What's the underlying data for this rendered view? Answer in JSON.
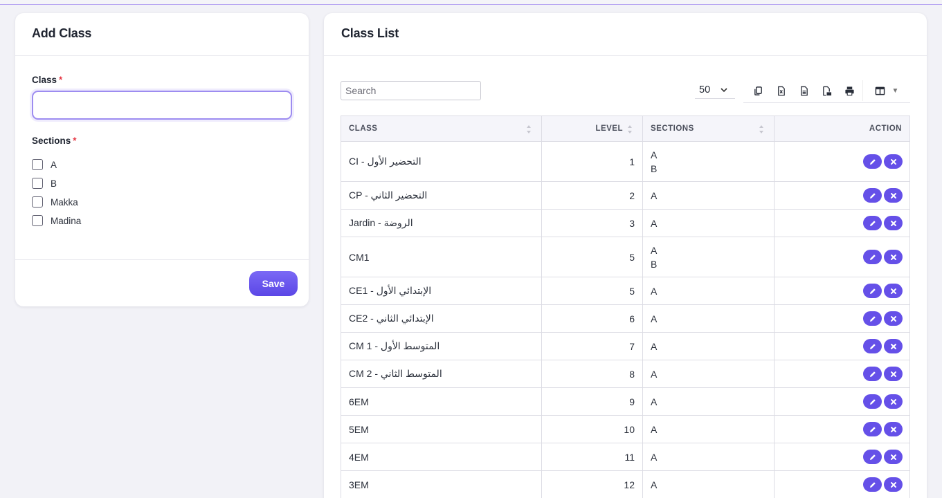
{
  "add_class": {
    "title": "Add Class",
    "class_label": "Class",
    "class_value": "",
    "sections_label": "Sections",
    "required_mark": "*",
    "sections": [
      "A",
      "B",
      "Makka",
      "Madina"
    ],
    "save_label": "Save"
  },
  "class_list": {
    "title": "Class List",
    "search_placeholder": "Search",
    "page_size": "50",
    "toolbar_icons": [
      "copy-icon",
      "excel-icon",
      "csv-icon",
      "pdf-icon",
      "print-icon",
      "columns-icon"
    ],
    "columns": [
      "CLASS",
      "LEVEL",
      "SECTIONS",
      "ACTION"
    ],
    "rows": [
      {
        "class": "CI - التحضير الأول",
        "level": "1",
        "sections": [
          "A",
          "B"
        ]
      },
      {
        "class": "CP - التحضير الثاني",
        "level": "2",
        "sections": [
          "A"
        ]
      },
      {
        "class": "Jardin - الروضة",
        "level": "3",
        "sections": [
          "A"
        ]
      },
      {
        "class": "CM1",
        "level": "5",
        "sections": [
          "A",
          "B"
        ]
      },
      {
        "class": "CE1 - الإبتدائي الأول",
        "level": "5",
        "sections": [
          "A"
        ]
      },
      {
        "class": "CE2 - الإبتدائي الثاني",
        "level": "6",
        "sections": [
          "A"
        ]
      },
      {
        "class": "CM 1 - المتوسط الأول",
        "level": "7",
        "sections": [
          "A"
        ]
      },
      {
        "class": "CM 2 - المتوسط الثاني",
        "level": "8",
        "sections": [
          "A"
        ]
      },
      {
        "class": "6EM",
        "level": "9",
        "sections": [
          "A"
        ]
      },
      {
        "class": "5EM",
        "level": "10",
        "sections": [
          "A"
        ]
      },
      {
        "class": "4EM",
        "level": "11",
        "sections": [
          "A"
        ]
      },
      {
        "class": "3EM",
        "level": "12",
        "sections": [
          "A"
        ]
      }
    ]
  },
  "colors": {
    "accent": "#6550e8",
    "input_focus": "#9d8cf0",
    "required": "#e63946"
  }
}
